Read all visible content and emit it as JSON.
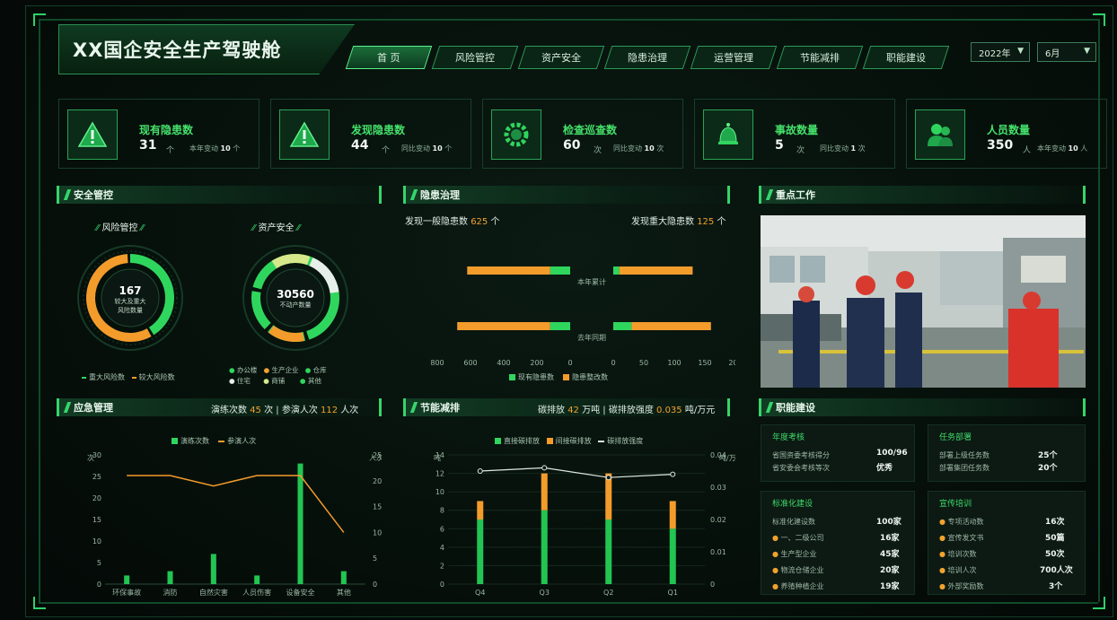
{
  "app": {
    "title": "XX国企安全生产驾驶舱"
  },
  "nav": {
    "tabs": [
      "首 页",
      "风险管控",
      "资产安全",
      "隐患治理",
      "运营管理",
      "节能减排",
      "职能建设"
    ],
    "active_index": 0
  },
  "filters": {
    "year": "2022年",
    "month": "6月"
  },
  "kpis": [
    {
      "label": "现有隐患数",
      "value": "31",
      "unit": "个",
      "change_label": "本年变动",
      "change_value": "10",
      "change_unit": "个",
      "icon": "warning-icon"
    },
    {
      "label": "发现隐患数",
      "value": "44",
      "unit": "个",
      "change_label": "同比变动",
      "change_value": "10",
      "change_unit": "个",
      "icon": "alert-icon"
    },
    {
      "label": "检查巡查数",
      "value": "60",
      "unit": "次",
      "change_label": "同比变动",
      "change_value": "10",
      "change_unit": "次",
      "icon": "gear-icon"
    },
    {
      "label": "事故数量",
      "value": "5",
      "unit": "次",
      "change_label": "同比变动",
      "change_value": "1",
      "change_unit": "次",
      "icon": "bell-icon"
    },
    {
      "label": "人员数量",
      "value": "350",
      "unit": "人",
      "change_label": "本年变动",
      "change_value": "10",
      "change_unit": "人",
      "icon": "people-icon"
    }
  ],
  "safety": {
    "title": "安全管控",
    "risk": {
      "title": "风险管控",
      "value": "167",
      "caption1": "较大及重大",
      "caption2": "风险数量",
      "legend": [
        "重大风险数",
        "较大风险数"
      ],
      "major": 0.42,
      "big": 0.58
    },
    "asset": {
      "title": "资产安全",
      "value": "30560",
      "caption": "不动产数量",
      "legend": [
        "办公楼",
        "生产企业",
        "仓库",
        "住宅",
        "商铺",
        "其他"
      ]
    }
  },
  "hazard": {
    "title": "隐患治理",
    "general_label": "发现一般隐患数",
    "general_value": "625",
    "general_unit": "个",
    "major_label": "发现重大隐患数",
    "major_value": "125",
    "major_unit": "个",
    "row_labels": [
      "本年累计",
      "去年同期"
    ],
    "left_ticks": [
      "800",
      "600",
      "400",
      "200",
      "0"
    ],
    "right_ticks": [
      "0",
      "50",
      "100",
      "150",
      "200"
    ],
    "legend": [
      "现有隐患数",
      "隐患整改数"
    ],
    "chart_data": {
      "type": "bar",
      "categories": [
        "本年累计",
        "去年同期"
      ],
      "general": {
        "existing": [
          120,
          120
        ],
        "rectified": [
          500,
          560
        ]
      },
      "major": {
        "existing": [
          10,
          30
        ],
        "rectified": [
          120,
          130
        ]
      },
      "left_xlim": [
        0,
        800
      ],
      "right_xlim": [
        0,
        200
      ]
    }
  },
  "key_work": {
    "title": "重点工作"
  },
  "emergency": {
    "title": "应急管理",
    "summary_a": "演练次数",
    "summary_a_val": "45",
    "summary_a_unit": "次",
    "summary_b": "参演人次",
    "summary_b_val": "112",
    "summary_b_unit": "人次",
    "ylabel_left": "次",
    "ylabel_right": "人次",
    "legend": [
      "演练次数",
      "参演人次"
    ],
    "chart_data": {
      "type": "bar",
      "categories": [
        "环保事故",
        "消防",
        "自然灾害",
        "人员伤害",
        "设备安全",
        "其他"
      ],
      "series": [
        {
          "name": "演练次数",
          "type": "bar",
          "values": [
            2,
            3,
            7,
            2,
            28,
            3
          ]
        },
        {
          "name": "参演人次",
          "type": "line",
          "values": [
            21,
            21,
            19,
            21,
            21,
            10
          ]
        }
      ],
      "ylim_left": [
        0,
        30
      ],
      "ylim_right": [
        0,
        25
      ],
      "yticks_left": [
        "30",
        "25",
        "20",
        "15",
        "10",
        "5",
        "0"
      ],
      "yticks_right": [
        "25",
        "20",
        "15",
        "10",
        "5",
        "0"
      ]
    }
  },
  "energy": {
    "title": "节能减排",
    "summary_a": "碳排放",
    "summary_a_val": "42",
    "summary_a_unit": "万吨",
    "summary_b": "碳排放强度",
    "summary_b_val": "0.035",
    "summary_b_unit": "吨/万元",
    "ylabel_left": "吨",
    "ylabel_right": "吨/万元",
    "legend": [
      "直接碳排放",
      "间接碳排放",
      "碳排放强度"
    ],
    "chart_data": {
      "type": "bar",
      "categories": [
        "Q4",
        "Q3",
        "Q2",
        "Q1"
      ],
      "series": [
        {
          "name": "直接碳排放",
          "values": [
            7,
            8,
            7,
            6
          ]
        },
        {
          "name": "间接碳排放",
          "values": [
            2,
            4,
            5,
            3
          ]
        },
        {
          "name": "碳排放强度",
          "type": "line",
          "values": [
            0.035,
            0.036,
            0.033,
            0.034
          ]
        }
      ],
      "ylim_left": [
        0,
        14
      ],
      "ylim_right": [
        0,
        0.04
      ],
      "yticks_left": [
        "14",
        "12",
        "10",
        "8",
        "6",
        "4",
        "2",
        "0"
      ],
      "yticks_right": [
        "0.04",
        "0.03",
        "0.02",
        "0.01",
        "0"
      ]
    }
  },
  "functions": {
    "title": "职能建设",
    "annual": {
      "title": "年度考核",
      "rows": [
        {
          "label": "省国资委考核得分",
          "value": "100/96"
        },
        {
          "label": "省安委会考核等次",
          "value": "优秀"
        }
      ]
    },
    "tasks": {
      "title": "任务部署",
      "rows": [
        {
          "label": "部署上级任务数",
          "value": "25个"
        },
        {
          "label": "部署集团任务数",
          "value": "20个"
        }
      ]
    },
    "standard": {
      "title": "标准化建设",
      "rows": [
        {
          "label": "标准化建设数",
          "value": "100家"
        },
        {
          "label": "一、二级公司",
          "value": "16家"
        },
        {
          "label": "生产型企业",
          "value": "45家"
        },
        {
          "label": "物流仓储企业",
          "value": "20家"
        },
        {
          "label": "养殖种植企业",
          "value": "19家"
        }
      ]
    },
    "training": {
      "title": "宣传培训",
      "rows": [
        {
          "label": "专项活动数",
          "value": "16次"
        },
        {
          "label": "宣传发文书",
          "value": "50篇"
        },
        {
          "label": "培训次数",
          "value": "50次"
        },
        {
          "label": "培训人次",
          "value": "700人次"
        },
        {
          "label": "外部奖励数",
          "value": "3个"
        }
      ]
    }
  },
  "colors": {
    "green": "#2fd65d",
    "orange": "#f39c2b",
    "accent": "#35d56b"
  }
}
